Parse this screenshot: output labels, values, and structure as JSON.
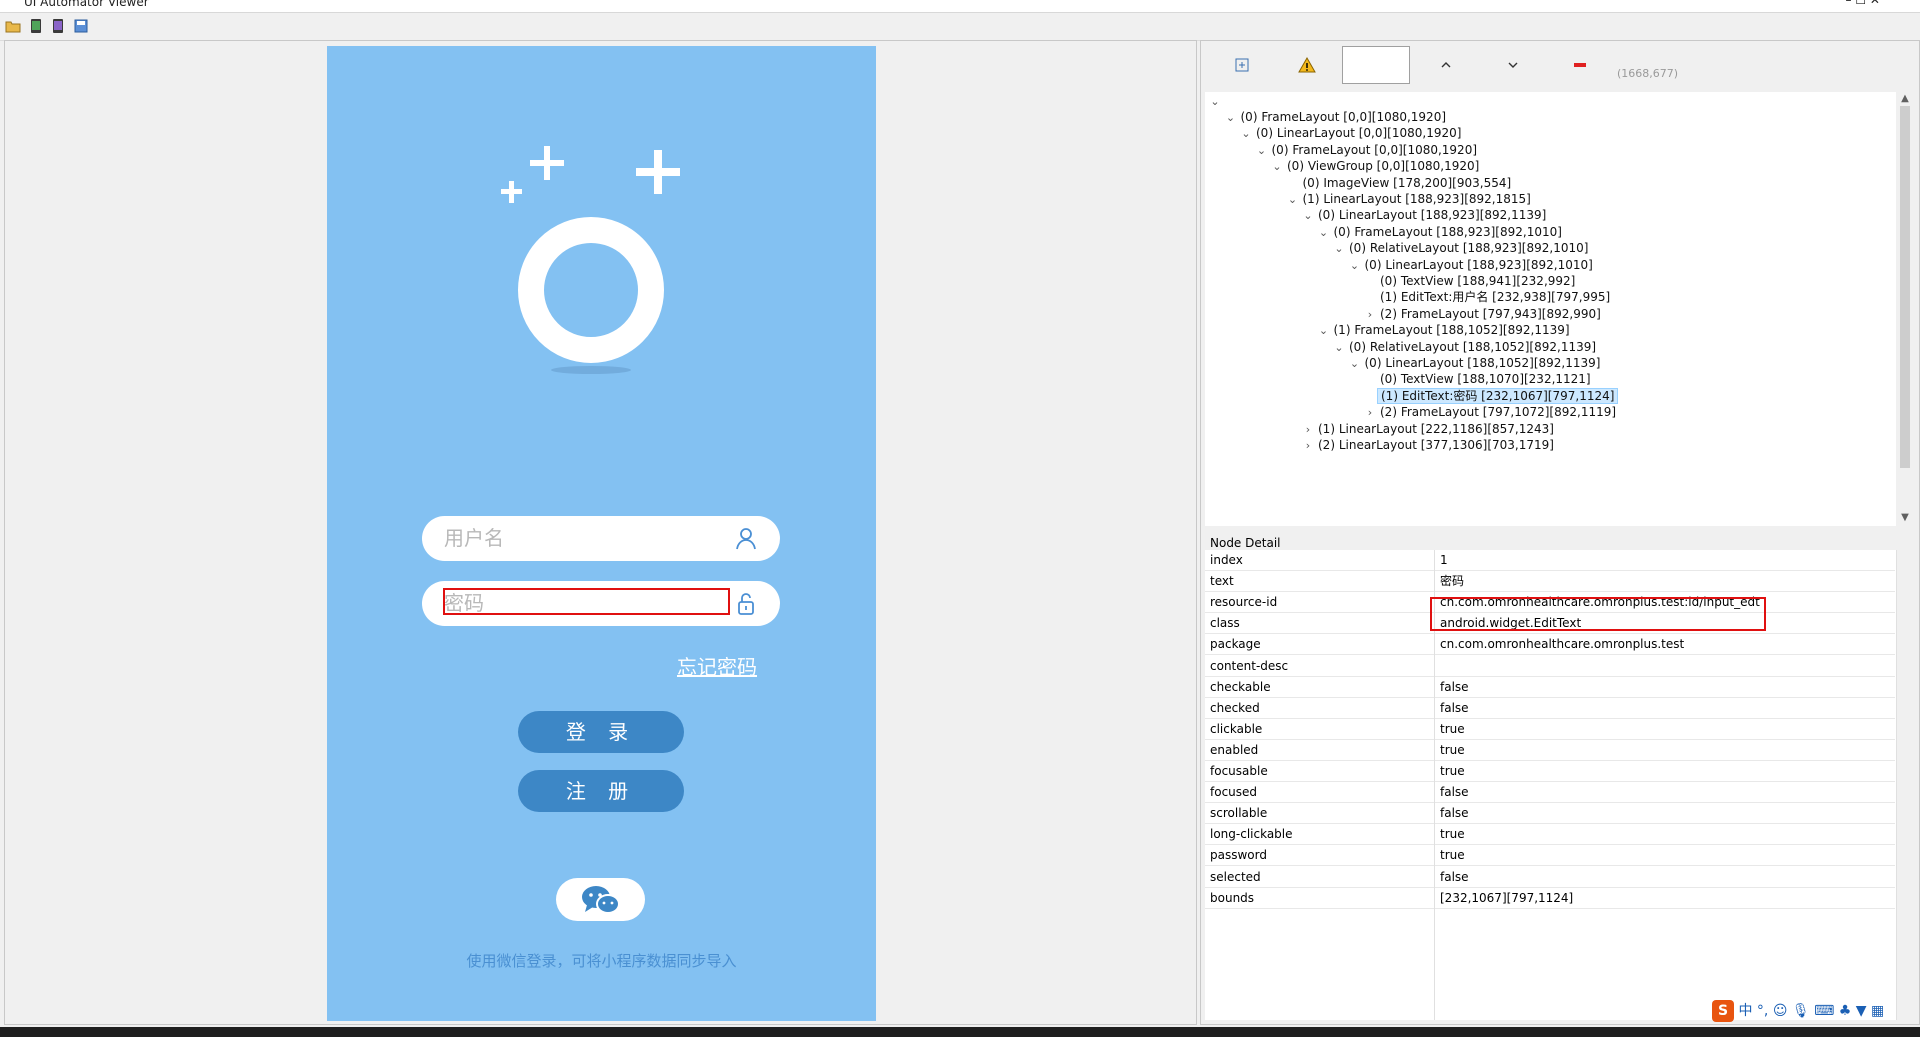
{
  "window": {
    "title": "UI Automator Viewer",
    "controls": "–   ☐   ✕"
  },
  "toolbar": {
    "items": [
      "open-icon",
      "device-screenshot-icon",
      "device-screenshot-compressed-icon",
      "save-icon"
    ]
  },
  "phone": {
    "username_placeholder": "用户名",
    "password_placeholder": "密码",
    "forgot_password": "忘记密码",
    "login_button": "登 录",
    "register_button": "注 册",
    "wechat_hint": "使用微信登录，可将小程序数据同步导入"
  },
  "right_toolbar": {
    "coords": "(1668,677)",
    "tools": [
      "expand-all-icon",
      "warning-icon",
      "blank-field",
      "previous-icon",
      "next-icon",
      "remove-icon"
    ]
  },
  "tree": {
    "root_arrow": "⌄",
    "nodes": [
      {
        "label": "(0) FrameLayout [0,0][1080,1920]",
        "arrow": "⌄",
        "selected": false
      },
      {
        "label": "(0) LinearLayout [0,0][1080,1920]",
        "arrow": "⌄",
        "selected": false
      },
      {
        "label": "(0) FrameLayout [0,0][1080,1920]",
        "arrow": "⌄",
        "selected": false
      },
      {
        "label": "(0) ViewGroup [0,0][1080,1920]",
        "arrow": "⌄",
        "selected": false
      },
      {
        "label": "(0) ImageView [178,200][903,554]",
        "arrow": "",
        "selected": false
      },
      {
        "label": "(1) LinearLayout [188,923][892,1815]",
        "arrow": "⌄",
        "selected": false
      },
      {
        "label": "(0) LinearLayout [188,923][892,1139]",
        "arrow": "⌄",
        "selected": false
      },
      {
        "label": "(0) FrameLayout [188,923][892,1010]",
        "arrow": "⌄",
        "selected": false
      },
      {
        "label": "(0) RelativeLayout [188,923][892,1010]",
        "arrow": "⌄",
        "selected": false
      },
      {
        "label": "(0) LinearLayout [188,923][892,1010]",
        "arrow": "⌄",
        "selected": false
      },
      {
        "label": "(0) TextView [188,941][232,992]",
        "arrow": "",
        "selected": false
      },
      {
        "label": "(1) EditText:用户名 [232,938][797,995]",
        "arrow": "",
        "selected": false
      },
      {
        "label": "(2) FrameLayout [797,943][892,990]",
        "arrow": "›",
        "selected": false
      },
      {
        "label": "(1) FrameLayout [188,1052][892,1139]",
        "arrow": "⌄",
        "selected": false
      },
      {
        "label": "(0) RelativeLayout [188,1052][892,1139]",
        "arrow": "⌄",
        "selected": false
      },
      {
        "label": "(0) LinearLayout [188,1052][892,1139]",
        "arrow": "⌄",
        "selected": false
      },
      {
        "label": "(0) TextView [188,1070][232,1121]",
        "arrow": "",
        "selected": false
      },
      {
        "label": "(1) EditText:密码 [232,1067][797,1124]",
        "arrow": "",
        "selected": true
      },
      {
        "label": "(2) FrameLayout [797,1072][892,1119]",
        "arrow": "›",
        "selected": false
      },
      {
        "label": "(1) LinearLayout [222,1186][857,1243]",
        "arrow": "›",
        "selected": false
      },
      {
        "label": "(2) LinearLayout [377,1306][703,1719]",
        "arrow": "›",
        "selected": false
      }
    ]
  },
  "detail": {
    "header": "Node Detail",
    "rows": [
      {
        "key": "index",
        "value": "1"
      },
      {
        "key": "text",
        "value": "密码"
      },
      {
        "key": "resource-id",
        "value": "cn.com.omronhealthcare.omronplus.test:id/input_edt"
      },
      {
        "key": "class",
        "value": "android.widget.EditText"
      },
      {
        "key": "package",
        "value": "cn.com.omronhealthcare.omronplus.test"
      },
      {
        "key": "content-desc",
        "value": ""
      },
      {
        "key": "checkable",
        "value": "false"
      },
      {
        "key": "checked",
        "value": "false"
      },
      {
        "key": "clickable",
        "value": "true"
      },
      {
        "key": "enabled",
        "value": "true"
      },
      {
        "key": "focusable",
        "value": "true"
      },
      {
        "key": "focused",
        "value": "false"
      },
      {
        "key": "scrollable",
        "value": "false"
      },
      {
        "key": "long-clickable",
        "value": "true"
      },
      {
        "key": "password",
        "value": "true"
      },
      {
        "key": "selected",
        "value": "false"
      },
      {
        "key": "bounds",
        "value": "[232,1067][797,1124]"
      }
    ]
  },
  "ime": {
    "logo": "S",
    "mode": "中"
  },
  "colors": {
    "phone_bg": "#83c1f2",
    "button": "#3d87c6",
    "highlight": "#e01010",
    "selection": "#cce8ff"
  }
}
